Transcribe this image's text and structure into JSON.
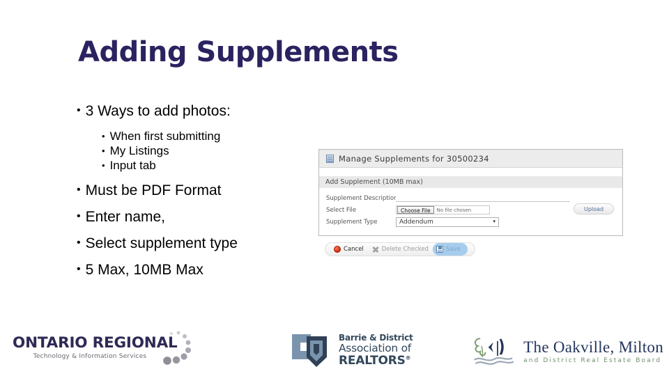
{
  "slide": {
    "title": "Adding Supplements",
    "title_color": "#2b2360",
    "bullets": [
      {
        "level": 1,
        "text": "3 Ways to add photos:"
      },
      {
        "level": 2,
        "text": "When first submitting"
      },
      {
        "level": 2,
        "text": "My Listings"
      },
      {
        "level": 2,
        "text": "Input tab"
      },
      {
        "level": 1,
        "text": "Must be PDF Format"
      },
      {
        "level": 1,
        "text": "Enter name,"
      },
      {
        "level": 1,
        "text": "Select supplement type"
      },
      {
        "level": 1,
        "text": "5 Max, 10MB Max"
      }
    ]
  },
  "screenshot": {
    "header_title": "Manage Supplements for 30500234",
    "section_title": "Add Supplement (10MB max)",
    "fields": {
      "description_label": "Supplement Description",
      "description_value": "",
      "file_label": "Select File",
      "choose_file_label": "Choose File",
      "no_file_text": "No file chosen",
      "type_label": "Supplement Type",
      "type_value": "Addendum",
      "type_options": [
        "Addendum"
      ]
    },
    "upload_label": "Upload",
    "actions": [
      {
        "label": "Cancel",
        "icon": "cancel-icon",
        "state": "enabled"
      },
      {
        "label": "Delete Checked",
        "icon": "x-icon",
        "state": "disabled"
      },
      {
        "label": "Save",
        "icon": "save-icon",
        "state": "highlighted"
      }
    ]
  },
  "footer": {
    "ontario": {
      "name": "ONTARIO REGIONAL",
      "tagline": "Technology & Information Services",
      "color": "#2e2a55"
    },
    "barrie": {
      "line1": "Barrie & District",
      "line2": "Association of",
      "line3": "REALTORS",
      "trademark": "®",
      "color": "#33485c"
    },
    "oakville": {
      "line1": "The Oakville, Milton",
      "line2": "and District Real Estate Board",
      "color": "#24355c",
      "accent": "#6f8f6b"
    }
  }
}
